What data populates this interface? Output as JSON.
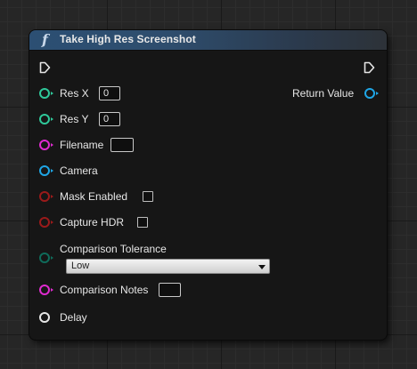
{
  "node": {
    "icon": "function-icon",
    "function_symbol": "f",
    "title": "Take High Res Screenshot"
  },
  "pins": {
    "res_x": {
      "label": "Res X",
      "value": "0",
      "color": "#2fc89a"
    },
    "res_y": {
      "label": "Res Y",
      "value": "0",
      "color": "#2fc89a"
    },
    "filename": {
      "label": "Filename",
      "value": "",
      "color": "#e02bd0"
    },
    "camera": {
      "label": "Camera",
      "color": "#1fa6e6"
    },
    "mask_enabled": {
      "label": "Mask Enabled",
      "checked": false,
      "color": "#9a1a1a"
    },
    "capture_hdr": {
      "label": "Capture HDR",
      "checked": false,
      "color": "#9a1a1a"
    },
    "comparison_tolerance": {
      "label": "Comparison Tolerance",
      "selected": "Low",
      "color": "#0f6b5a"
    },
    "comparison_notes": {
      "label": "Comparison Notes",
      "value": "",
      "color": "#e02bd0"
    },
    "delay": {
      "label": "Delay",
      "color": "#e6e6e6"
    },
    "return_value": {
      "label": "Return Value",
      "color": "#1fa6e6"
    }
  }
}
